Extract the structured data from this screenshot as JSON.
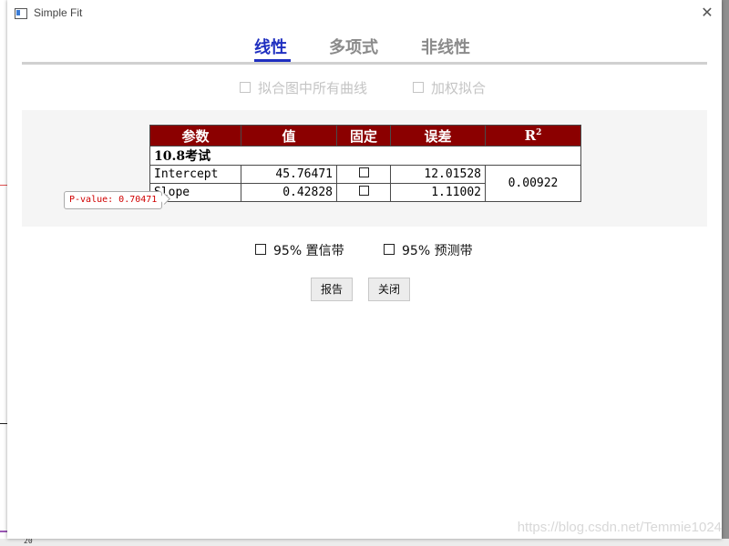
{
  "window": {
    "title": "Simple Fit"
  },
  "tabs": [
    {
      "label": "线性",
      "active": true
    },
    {
      "label": "多项式",
      "active": false
    },
    {
      "label": "非线性",
      "active": false
    }
  ],
  "options": {
    "all_curves": {
      "label": "拟合图中所有曲线",
      "checked": false,
      "enabled": false
    },
    "weighted": {
      "label": "加权拟合",
      "checked": false,
      "enabled": false
    }
  },
  "table": {
    "headers": [
      "参数",
      "值",
      "固定",
      "误差",
      "R"
    ],
    "r2_superscript": "2",
    "group": "10.8考试",
    "rows": [
      {
        "param": "Intercept",
        "value": "45.76471",
        "fixed": false,
        "error": "12.01528"
      },
      {
        "param": "Slope",
        "value": "0.42828",
        "fixed": false,
        "error": "1.11002"
      }
    ],
    "r2": "0.00922",
    "pvalue_tag": "P-value: 0.70471"
  },
  "bands": {
    "confidence": {
      "label": "95% 置信带",
      "checked": false
    },
    "prediction": {
      "label": "95% 预测带",
      "checked": false
    }
  },
  "buttons": {
    "report": "报告",
    "close": "关闭"
  },
  "watermark": "https://blog.csdn.net/Temmie1024",
  "background": {
    "axis_number": "20"
  },
  "colors": {
    "accent": "#1f2fc0",
    "header": "#8b0000",
    "pvalue": "#d00000"
  }
}
